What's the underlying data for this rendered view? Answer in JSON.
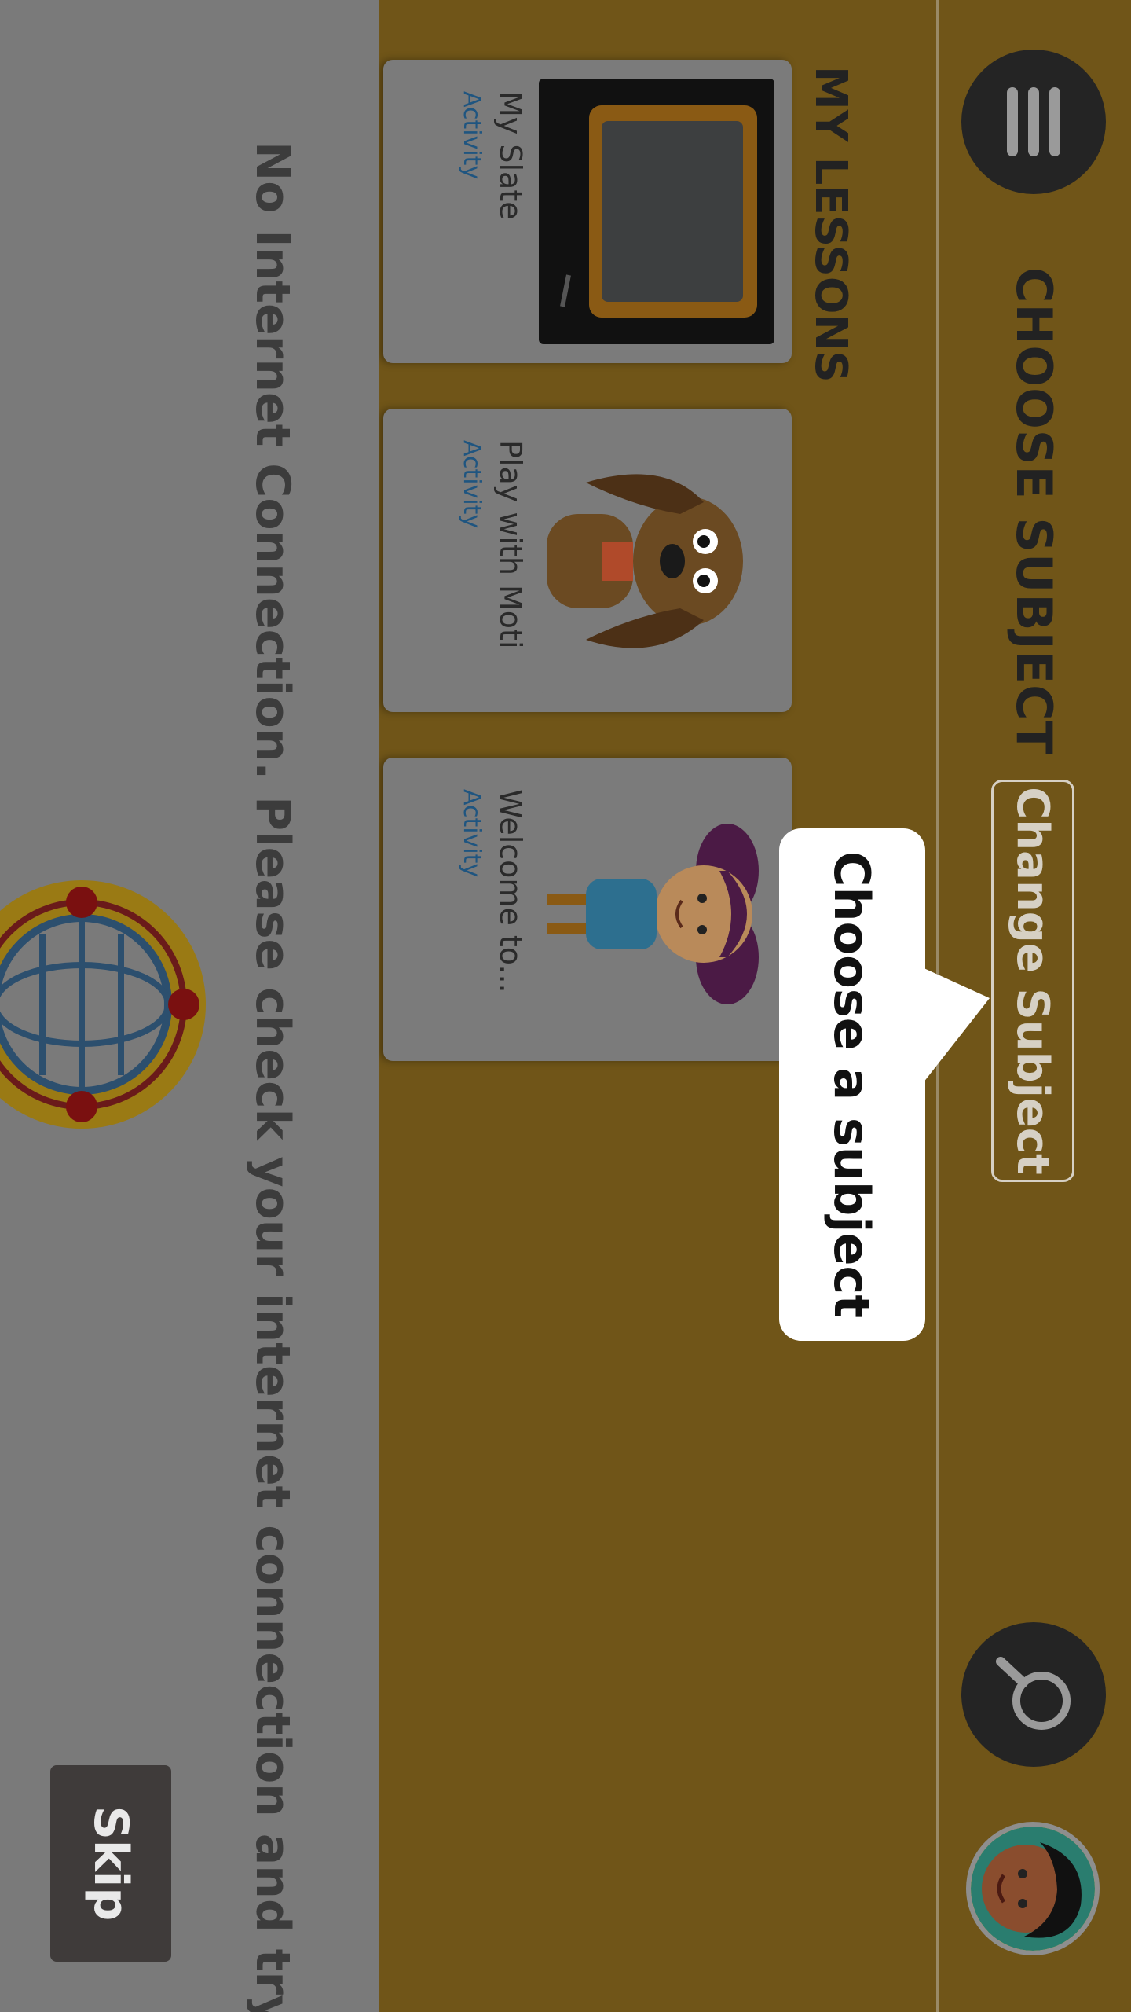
{
  "topbar": {
    "title": "CHOOSE SUBJECT",
    "change_subject_label": "Change Subject",
    "menu_icon": "hamburger-menu-icon",
    "search_icon": "search-icon",
    "avatar_icon": "child-avatar-icon"
  },
  "lessons": {
    "section_title": "MY LESSONS",
    "cards": [
      {
        "title": "My Slate",
        "type": "Activity",
        "image": "slate-chalkboard-image"
      },
      {
        "title": "Play with Moti",
        "type": "Activity",
        "image": "moti-dog-image"
      },
      {
        "title": "Welcome to...",
        "type": "Activity",
        "image": "girl-character-image"
      }
    ]
  },
  "tooltip": {
    "text": "Choose a subject"
  },
  "overlay": {
    "message": "No Internet Connection. Please check your internet connection and try again.",
    "globe_icon": "globe-icon",
    "skip_label": "Skip"
  },
  "colors": {
    "topbar_bg": "#705518",
    "overlay_bg": "#7a7a7a",
    "card_bg": "#7b7b7b",
    "activity_text": "#1f5580"
  }
}
